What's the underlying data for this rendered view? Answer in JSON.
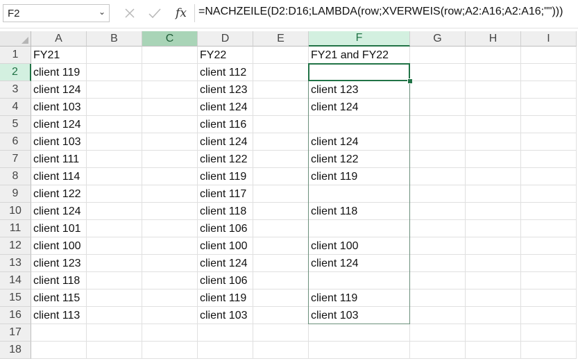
{
  "name_box": {
    "value": "F2"
  },
  "formula_bar": {
    "formula": "=NACHZEILE(D2:D16;LAMBDA(row;XVERWEIS(row;A2:A16;A2:A16;\"\")))",
    "fx_label": "fx"
  },
  "columns": [
    "A",
    "B",
    "C",
    "D",
    "E",
    "F",
    "G",
    "H",
    "I"
  ],
  "rows": [
    "1",
    "2",
    "3",
    "4",
    "5",
    "6",
    "7",
    "8",
    "9",
    "10",
    "11",
    "12",
    "13",
    "14",
    "15",
    "16",
    "17",
    "18"
  ],
  "active_cell": "F2",
  "colA": [
    "FY21",
    "client 119",
    "client 124",
    "client 103",
    "client 124",
    "client 103",
    "client 111",
    "client 114",
    "client 122",
    "client 124",
    "client 101",
    "client 100",
    "client 123",
    "client 118",
    "client 115",
    "client 113"
  ],
  "colD": [
    "FY22",
    "client 112",
    "client 123",
    "client 124",
    "client 116",
    "client 124",
    "client 122",
    "client 119",
    "client 117",
    "client 118",
    "client 106",
    "client 100",
    "client 124",
    "client 106",
    "client 119",
    "client 103"
  ],
  "colF": [
    "FY21 and FY22",
    "",
    "client 123",
    "client 124",
    "",
    "client 124",
    "client 122",
    "client 119",
    "",
    "client 118",
    "",
    "client 100",
    "client 124",
    "",
    "client 119",
    "client 103"
  ],
  "colors": {
    "accent": "#217346"
  }
}
